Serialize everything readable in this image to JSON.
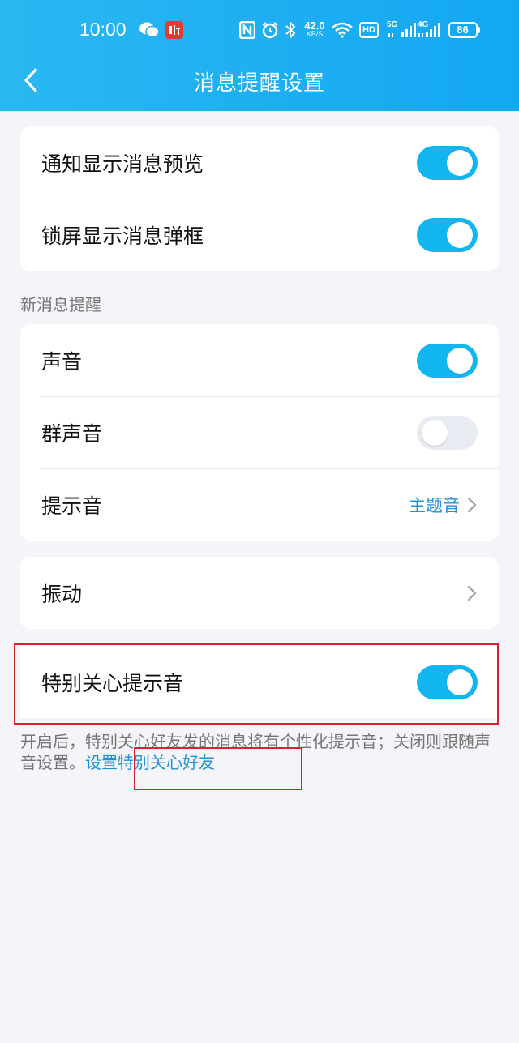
{
  "status_bar": {
    "time": "10:00",
    "speed_value": "42.0",
    "speed_unit": "KB/S",
    "hd_badge": "HD",
    "net_5g": "5G",
    "net_4g": "4G",
    "battery": "86",
    "icons": [
      "wechat-icon",
      "listen-app-icon",
      "nfc-icon",
      "alarm-icon",
      "bluetooth-icon",
      "wifi-icon",
      "signal-icon",
      "battery-icon"
    ]
  },
  "nav": {
    "title": "消息提醒设置"
  },
  "card_top": {
    "rows": [
      {
        "label": "通知显示消息预览",
        "on": true
      },
      {
        "label": "锁屏显示消息弹框",
        "on": true
      }
    ]
  },
  "section_new_msg": {
    "title": "新消息提醒",
    "rows": [
      {
        "label": "声音",
        "on": true
      },
      {
        "label": "群声音",
        "on": false
      },
      {
        "label": "提示音",
        "value": "主题音"
      }
    ]
  },
  "vibration": {
    "label": "振动"
  },
  "special_care": {
    "label": "特别关心提示音",
    "on": true,
    "description": "开启后，特别关心好友发的消息将有个性化提示音；关闭则跟随声音设置。",
    "link": "设置特别关心好友"
  },
  "colors": {
    "header": "#13a7f2",
    "toggle_on": "#11b6f1",
    "link": "#1f91d8",
    "annotation": "#d6232f"
  }
}
